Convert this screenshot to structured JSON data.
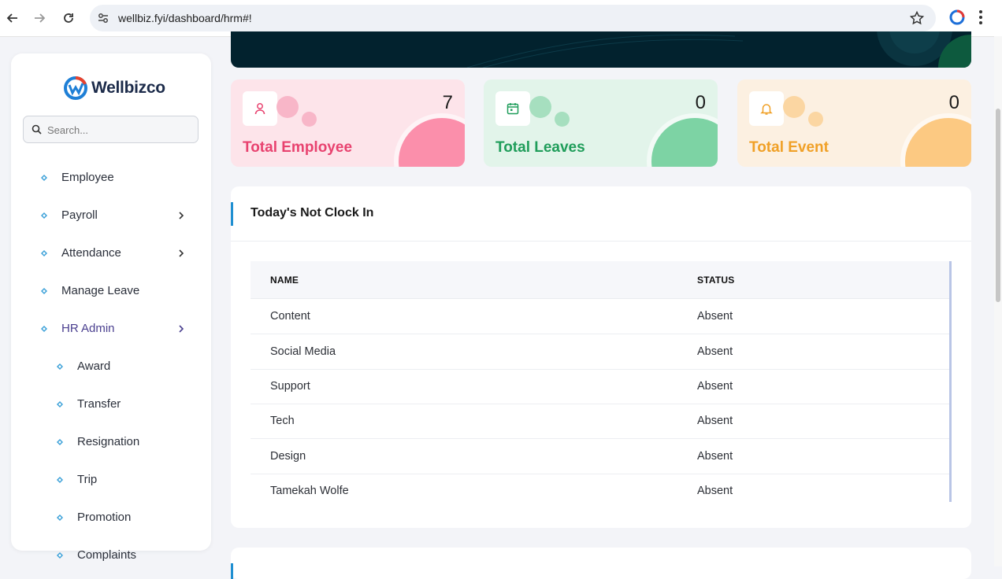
{
  "browser": {
    "url": "wellbiz.fyi/dashboard/hrm#!"
  },
  "sidebar": {
    "logo_text": "Wellbizco",
    "search_placeholder": "Search...",
    "items": [
      {
        "label": "Employee",
        "has_children": false
      },
      {
        "label": "Payroll",
        "has_children": true
      },
      {
        "label": "Attendance",
        "has_children": true
      },
      {
        "label": "Manage Leave",
        "has_children": false
      },
      {
        "label": "HR Admin",
        "has_children": true,
        "active": true
      }
    ],
    "subitems": [
      {
        "label": "Award"
      },
      {
        "label": "Transfer"
      },
      {
        "label": "Resignation"
      },
      {
        "label": "Trip"
      },
      {
        "label": "Promotion"
      },
      {
        "label": "Complaints"
      }
    ]
  },
  "stats": [
    {
      "label": "Total Employee",
      "value": "7",
      "icon": "user-icon",
      "accent": "#e8426f"
    },
    {
      "label": "Total Leaves",
      "value": "0",
      "icon": "calendar-icon",
      "accent": "#1f9d5a"
    },
    {
      "label": "Total Event",
      "value": "0",
      "icon": "bell-icon",
      "accent": "#f0a026"
    }
  ],
  "not_clocked_in": {
    "title": "Today's Not Clock In",
    "columns": [
      "NAME",
      "STATUS"
    ],
    "rows": [
      {
        "name": "Content",
        "status": "Absent"
      },
      {
        "name": "Social Media",
        "status": "Absent"
      },
      {
        "name": "Support",
        "status": "Absent"
      },
      {
        "name": "Tech",
        "status": "Absent"
      },
      {
        "name": "Design",
        "status": "Absent"
      },
      {
        "name": "Tamekah Wolfe",
        "status": "Absent"
      }
    ]
  }
}
